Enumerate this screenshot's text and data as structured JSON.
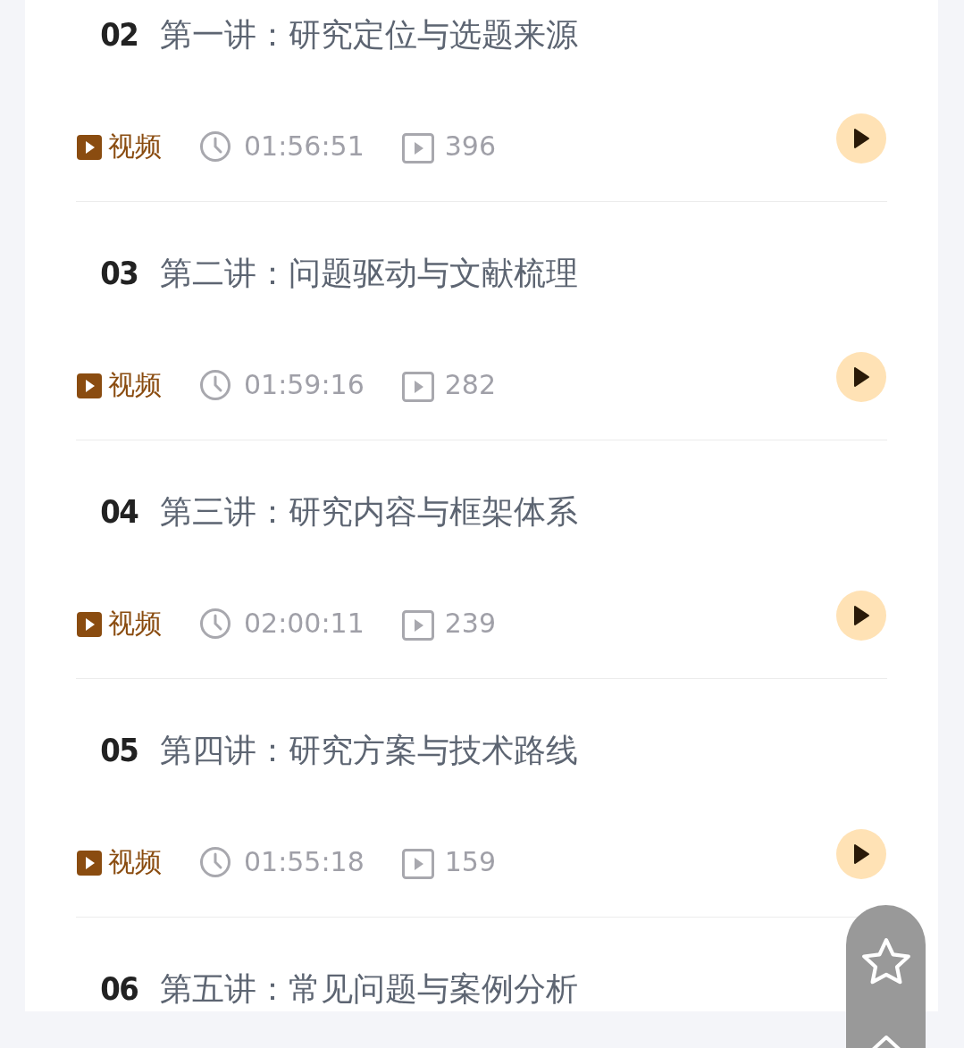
{
  "lessons": [
    {
      "number": "02",
      "title": "第一讲：研究定位与选题来源",
      "type": "视频",
      "duration": "01:56:51",
      "views": "396"
    },
    {
      "number": "03",
      "title": "第二讲：问题驱动与文献梳理",
      "type": "视频",
      "duration": "01:59:16",
      "views": "282"
    },
    {
      "number": "04",
      "title": "第三讲：研究内容与框架体系",
      "type": "视频",
      "duration": "02:00:11",
      "views": "239"
    },
    {
      "number": "05",
      "title": "第四讲：研究方案与技术路线",
      "type": "视频",
      "duration": "01:55:18",
      "views": "159"
    },
    {
      "number": "06",
      "title": "第五讲：常见问题与案例分析"
    }
  ]
}
